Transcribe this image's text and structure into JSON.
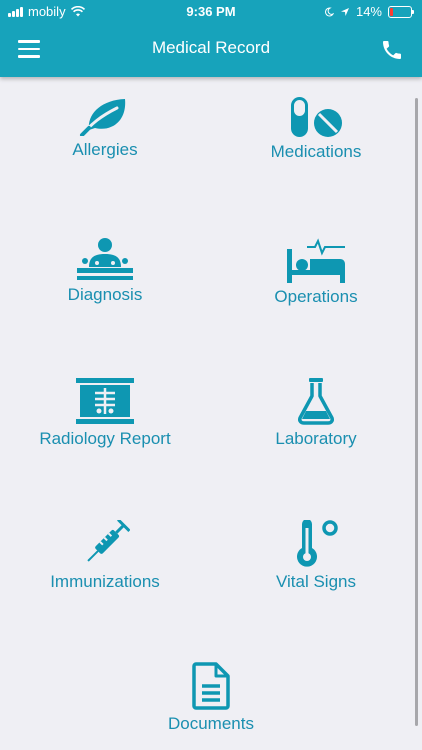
{
  "status_bar": {
    "carrier": "mobily",
    "time": "9:36 PM",
    "battery": "14%",
    "battery_level": 0.14
  },
  "header": {
    "title": "Medical Record",
    "menu_icon": "hamburger-menu-icon",
    "call_icon": "phone-icon"
  },
  "colors": {
    "header": "#17a3bb",
    "accent": "#1a8fb0",
    "background": "#efeff4"
  },
  "menu_items": [
    {
      "label": "Allergies",
      "icon": "leaf-icon"
    },
    {
      "label": "Medications",
      "icon": "pills-icon"
    },
    {
      "label": "Diagnosis",
      "icon": "patient-diagnosis-icon"
    },
    {
      "label": "Operations",
      "icon": "hospital-bed-icon"
    },
    {
      "label": "Radiology Report",
      "icon": "x-ray-icon"
    },
    {
      "label": "Laboratory",
      "icon": "flask-icon"
    },
    {
      "label": "Immunizations",
      "icon": "syringe-icon"
    },
    {
      "label": "Vital Signs",
      "icon": "thermometer-icon"
    },
    {
      "label": "Documents",
      "icon": "document-icon"
    }
  ]
}
